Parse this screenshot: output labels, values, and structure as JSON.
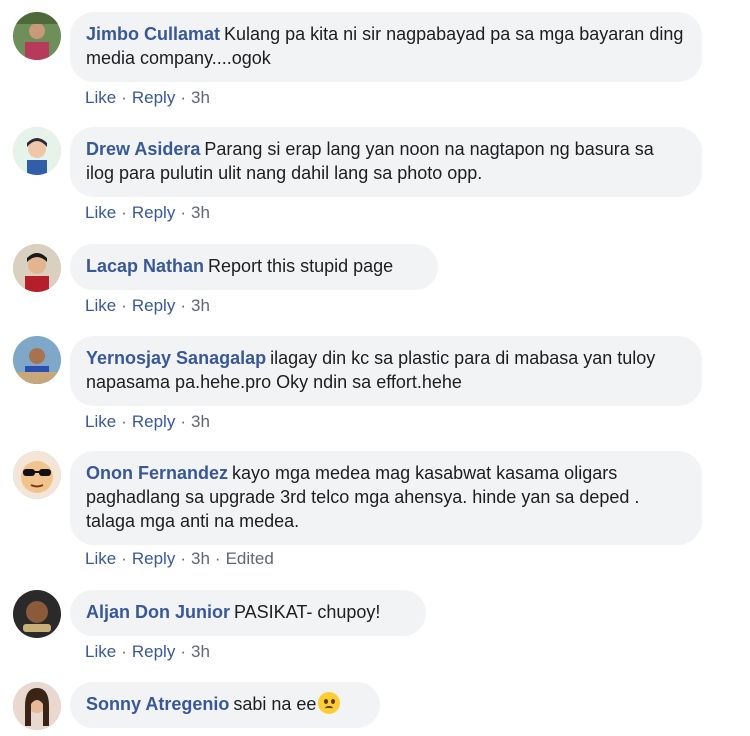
{
  "actions": {
    "like": "Like",
    "reply": "Reply",
    "dot": "·",
    "edited": "Edited"
  },
  "comments": [
    {
      "author": "Jimbo Cullamat",
      "text": "Kulang pa kita ni sir nagpabayad pa sa mga bayaran ding media company....ogok",
      "time": "3h"
    },
    {
      "author": "Drew Asidera",
      "text": "Parang si erap lang yan noon na nagtapon ng basura sa ilog para pulutin ulit nang dahil lang sa photo opp.",
      "time": "3h"
    },
    {
      "author": "Lacap Nathan",
      "text": "Report this stupid page",
      "time": "3h"
    },
    {
      "author": "Yernosjay Sanagalap",
      "text": "ilagay din kc sa plastic para di mabasa yan tuloy napasama pa.hehe.pro Oky ndin sa effort.hehe",
      "time": "3h"
    },
    {
      "author": "Onon Fernandez",
      "text": "kayo mga medea mag kasabwat kasama oligars paghadlang sa upgrade 3rd telco mga ahensya. hinde yan sa deped . talaga mga anti na medea.",
      "time": "3h"
    },
    {
      "author": "Aljan Don Junior",
      "text": "PASIKAT- chupoy!",
      "time": "3h"
    },
    {
      "author": "Sonny Atregenio",
      "text": "sabi na ee",
      "emoji": "rolling-eyes-emoji"
    }
  ],
  "colors": {
    "author": "#385898",
    "bubble": "#f2f3f5",
    "meta": "#606770"
  }
}
